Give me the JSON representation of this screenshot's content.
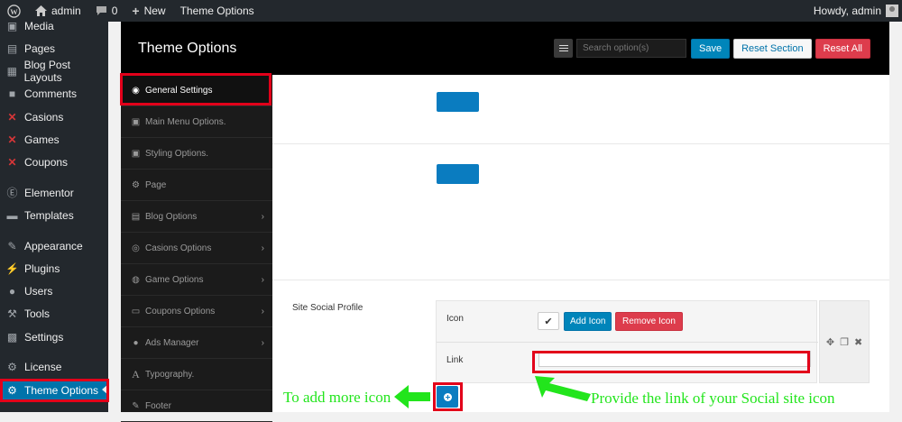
{
  "adminbar": {
    "site_name": "admin",
    "comments_count": "0",
    "new_label": "New",
    "theme_options_label": "Theme Options",
    "howdy": "Howdy, admin"
  },
  "menu": [
    {
      "label": "Media",
      "icon": "media-icon"
    },
    {
      "label": "Pages",
      "icon": "pages-icon"
    },
    {
      "label": "Blog Post Layouts",
      "icon": "layout-icon"
    },
    {
      "label": "Comments",
      "icon": "comment-icon"
    },
    {
      "label": "Casions",
      "icon": "cross-icon"
    },
    {
      "label": "Games",
      "icon": "cross-icon"
    },
    {
      "label": "Coupons",
      "icon": "cross-icon"
    },
    {
      "label": "Elementor",
      "icon": "elementor-icon"
    },
    {
      "label": "Templates",
      "icon": "folder-icon"
    },
    {
      "label": "Appearance",
      "icon": "brush-icon"
    },
    {
      "label": "Plugins",
      "icon": "plugin-icon"
    },
    {
      "label": "Users",
      "icon": "user-icon"
    },
    {
      "label": "Tools",
      "icon": "wrench-icon"
    },
    {
      "label": "Settings",
      "icon": "settings-icon"
    },
    {
      "label": "License",
      "icon": "gear-icon"
    },
    {
      "label": "Theme Options",
      "icon": "gear-icon"
    }
  ],
  "panel": {
    "title": "Theme Options",
    "search_placeholder": "Search option(s)",
    "save": "Save",
    "reset_section": "Reset Section",
    "reset_all": "Reset All"
  },
  "sections": [
    {
      "label": "General Settings",
      "icon": "dashboard-icon",
      "chevron": false
    },
    {
      "label": "Main Menu Options.",
      "icon": "menu-icon",
      "chevron": false
    },
    {
      "label": "Styling Options.",
      "icon": "style-icon",
      "chevron": false
    },
    {
      "label": "Page",
      "icon": "cogs-icon",
      "chevron": false
    },
    {
      "label": "Blog Options",
      "icon": "blog-icon",
      "chevron": true
    },
    {
      "label": "Casions Options",
      "icon": "chip-icon",
      "chevron": true
    },
    {
      "label": "Game Options",
      "icon": "gamepad-icon",
      "chevron": true
    },
    {
      "label": "Coupons Options",
      "icon": "coupon-icon",
      "chevron": true
    },
    {
      "label": "Ads Manager",
      "icon": "ads-icon",
      "chevron": true
    },
    {
      "label": "Typography.",
      "icon": "typography-icon",
      "chevron": false
    },
    {
      "label": "Footer",
      "icon": "edit-icon",
      "chevron": false
    }
  ],
  "social": {
    "label": "Site Social Profile",
    "icon_label": "Icon",
    "add_icon": "Add Icon",
    "remove_icon": "Remove Icon",
    "link_label": "Link",
    "link_value": ""
  },
  "annotations": {
    "add_more": "To add more icon",
    "provide_link": "Provide the link of your Social site icon"
  },
  "colors": {
    "annotation": "#22e51c",
    "highlight": "#e2001a",
    "accent_blue": "#0073aa"
  }
}
